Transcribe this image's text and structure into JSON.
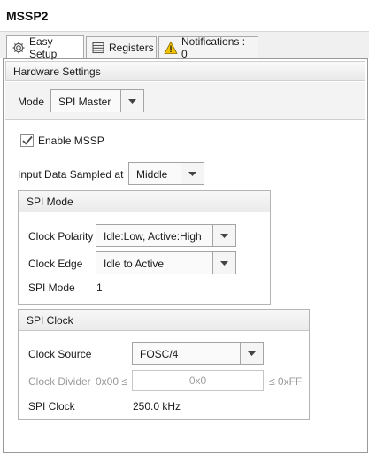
{
  "window": {
    "title": "MSSP2"
  },
  "tabs": [
    {
      "label": "Easy Setup",
      "icon": "gear-icon",
      "active": true
    },
    {
      "label": "Registers",
      "icon": "table-icon",
      "active": false
    },
    {
      "label": "Notifications : 0",
      "icon": "warning-icon",
      "active": false
    }
  ],
  "hardware": {
    "header": "Hardware Settings",
    "mode_label": "Mode",
    "mode_value": "SPI Master",
    "enable_label": "Enable MSSP",
    "enable_checked": true,
    "input_sampled_label": "Input Data Sampled at",
    "input_sampled_value": "Middle"
  },
  "spi_mode": {
    "header": "SPI Mode",
    "clock_polarity_label": "Clock Polarity",
    "clock_polarity_value": "Idle:Low, Active:High",
    "clock_edge_label": "Clock Edge",
    "clock_edge_value": "Idle to Active",
    "spi_mode_label": "SPI Mode",
    "spi_mode_value": "1"
  },
  "spi_clock": {
    "header": "SPI Clock",
    "clock_source_label": "Clock Source",
    "clock_source_value": "FOSC/4",
    "clock_divider_label": "Clock Divider",
    "divider_min": "0x00 ≤",
    "divider_value": "0x0",
    "divider_max": "≤ 0xFF",
    "spi_clock_label": "SPI Clock",
    "spi_clock_value": "250.0 kHz"
  },
  "colors": {
    "warning": "#f5c400",
    "border": "#a4a4a4",
    "disabled_text": "#9a9a9a"
  }
}
